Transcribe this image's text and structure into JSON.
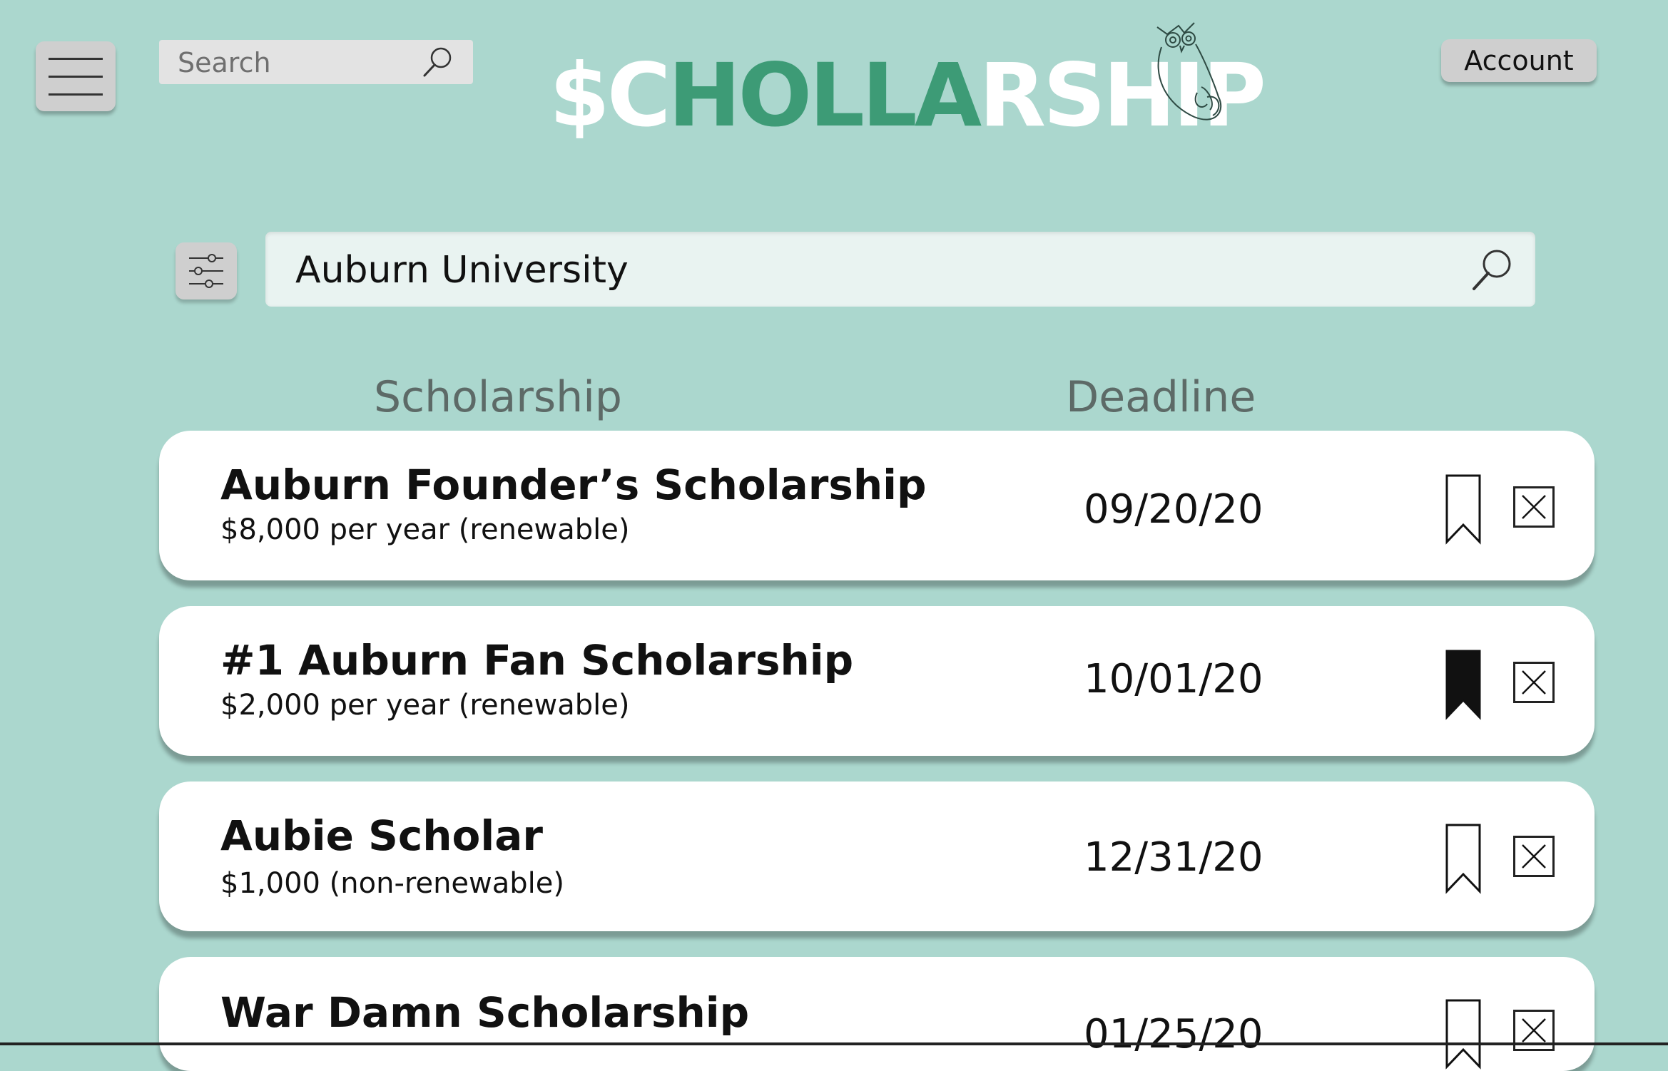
{
  "header": {
    "search_placeholder": "Search",
    "logo_parts": [
      "$C",
      "HOLLA",
      "RSHIP"
    ],
    "account_label": "Account"
  },
  "search": {
    "value": "Auburn University"
  },
  "columns": {
    "scholarship": "Scholarship",
    "deadline": "Deadline"
  },
  "scholarships": [
    {
      "title": "Auburn Founder’s Scholarship",
      "amount": "$8,000 per year (renewable)",
      "deadline": "09/20/20",
      "bookmarked": false
    },
    {
      "title": "#1 Auburn Fan Scholarship",
      "amount": "$2,000 per year (renewable)",
      "deadline": "10/01/20",
      "bookmarked": true
    },
    {
      "title": "Aubie Scholar",
      "amount": "$1,000 (non-renewable)",
      "deadline": "12/31/20",
      "bookmarked": false
    },
    {
      "title": "War Damn Scholarship",
      "amount": "",
      "deadline": "01/25/20",
      "bookmarked": false
    }
  ],
  "colors": {
    "background": "#abd7ce",
    "brand_green": "#3d9b76",
    "card": "#ffffff"
  },
  "icons": [
    "hamburger-menu-icon",
    "search-icon",
    "owl-icon",
    "filter-sliders-icon",
    "bookmark-icon",
    "close-icon"
  ]
}
